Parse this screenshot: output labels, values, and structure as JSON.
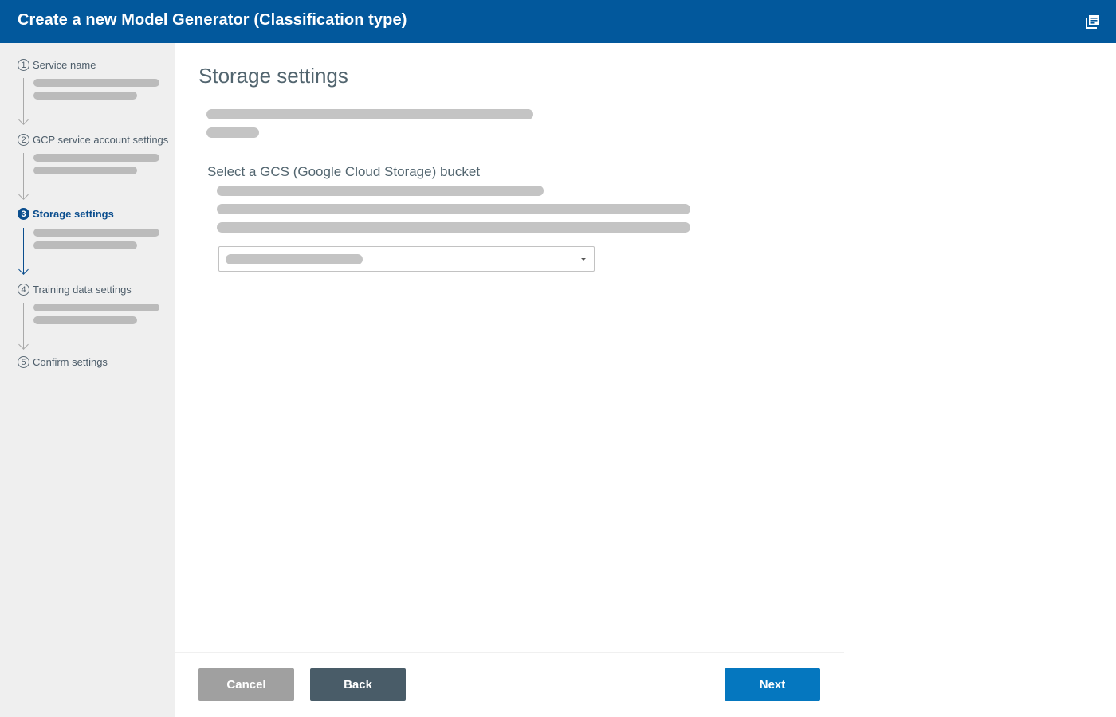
{
  "header": {
    "title": "Create a new Model Generator (Classification type)",
    "icon": "documents-icon"
  },
  "sidebar": {
    "steps": [
      {
        "number": "1",
        "label": "Service name",
        "state": "done"
      },
      {
        "number": "2",
        "label": "GCP service account settings",
        "state": "done"
      },
      {
        "number": "3",
        "label": "Storage settings",
        "state": "active"
      },
      {
        "number": "4",
        "label": "Training data settings",
        "state": "pending"
      },
      {
        "number": "5",
        "label": "Confirm settings",
        "state": "pending"
      }
    ]
  },
  "main": {
    "title": "Storage settings",
    "section_label": "Select a GCS (Google Cloud Storage) bucket",
    "bucket_select": {
      "selected": ""
    }
  },
  "footer": {
    "cancel_label": "Cancel",
    "back_label": "Back",
    "next_label": "Next"
  },
  "colors": {
    "header_bg": "#02589c",
    "active_step": "#0b4e8e",
    "next_button": "#0577bf",
    "back_button": "#495c68",
    "cancel_button": "#a0a0a0"
  }
}
